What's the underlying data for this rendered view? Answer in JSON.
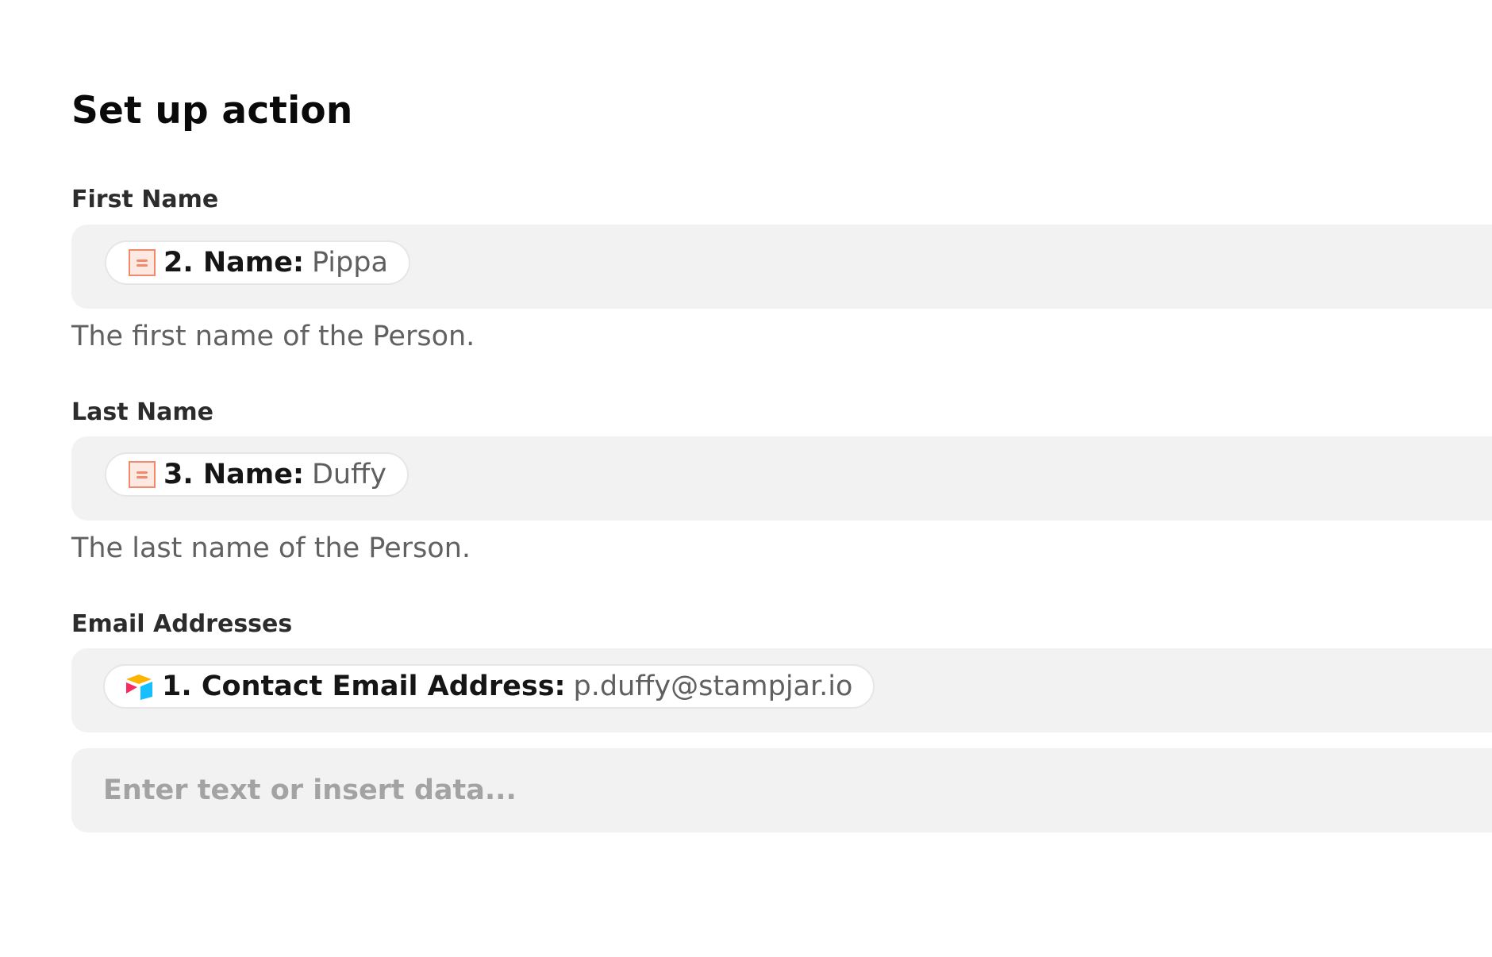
{
  "header": {
    "title": "Set up action"
  },
  "fields": [
    {
      "label": "First Name",
      "token_icon": "form-response-icon",
      "token_key": "2. Name:",
      "token_value": "Pippa",
      "help": "The first name of the Person."
    },
    {
      "label": "Last Name",
      "token_icon": "form-response-icon",
      "token_key": "3. Name:",
      "token_value": "Duffy",
      "help": "The last name of the Person."
    },
    {
      "label": "Email Addresses",
      "token_icon": "airtable-icon",
      "token_key": "1. Contact Email Address:",
      "token_value": "p.duffy@stampjar.io",
      "placeholder": "Enter text or insert data..."
    }
  ],
  "colors": {
    "field_background": "#f2f2f2",
    "form_icon_accent": "#f08a6b",
    "airtable_red": "#f82b60",
    "airtable_yellow": "#fcb400",
    "airtable_blue": "#18bfff"
  }
}
